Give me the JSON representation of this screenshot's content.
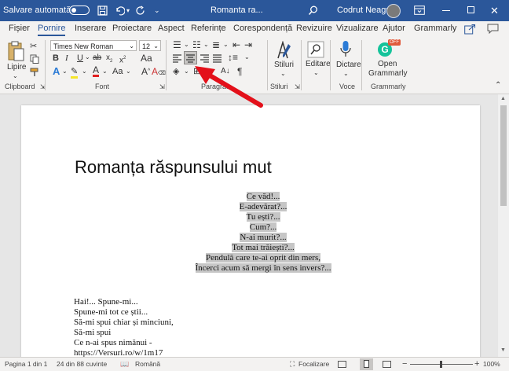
{
  "titlebar": {
    "autosave_label": "Salvare automată",
    "document_title": "Romanta ra...",
    "user_name": "Codrut Neagu",
    "accent": "#2b579a"
  },
  "tabs": [
    "Fișier",
    "Pornire",
    "Inserare",
    "Proiectare",
    "Aspect",
    "Referințe",
    "Corespondență",
    "Revizuire",
    "Vizualizare",
    "Ajutor",
    "Grammarly"
  ],
  "active_tab": "Pornire",
  "ribbon": {
    "clipboard": {
      "paste_label": "Lipire",
      "group_label": "Clipboard"
    },
    "font": {
      "font_name": "Times New Roman",
      "font_size": "12",
      "group_label": "Font"
    },
    "paragraph": {
      "group_label": "Paragraf"
    },
    "styles": {
      "label": "Stiluri",
      "group_label": "Stiluri"
    },
    "editing": {
      "label": "Editare"
    },
    "voice": {
      "dictate_label": "Dictare",
      "group_label": "Voce"
    },
    "grammarly": {
      "open_label_1": "Open",
      "open_label_2": "Grammarly",
      "group_label": "Grammarly",
      "badge": "OFF"
    }
  },
  "document": {
    "title": "Romanța răspunsului mut",
    "centered_lines": [
      "Ce văd!...",
      "E-adevărat?...",
      "Tu ești?...",
      "Cum?...",
      "N-ai murit?...",
      "Tot mai trăiești?...",
      "Pendulă care te-ai oprit din mers,",
      "Încerci acum să mergi în sens invers?..."
    ],
    "left_lines": [
      "Hai!... Spune-mi...",
      "Spune-mi tot ce știi...",
      "Să-mi spui chiar și minciuni,",
      "Să-mi spui",
      "Ce n-ai spus nimănui -",
      "https://Versuri.ro/w/1m17"
    ]
  },
  "status": {
    "page": "Pagina 1 din 1",
    "words": "24 din 88 cuvinte",
    "language": "Română",
    "focus": "Focalizare",
    "zoom": "100%"
  }
}
